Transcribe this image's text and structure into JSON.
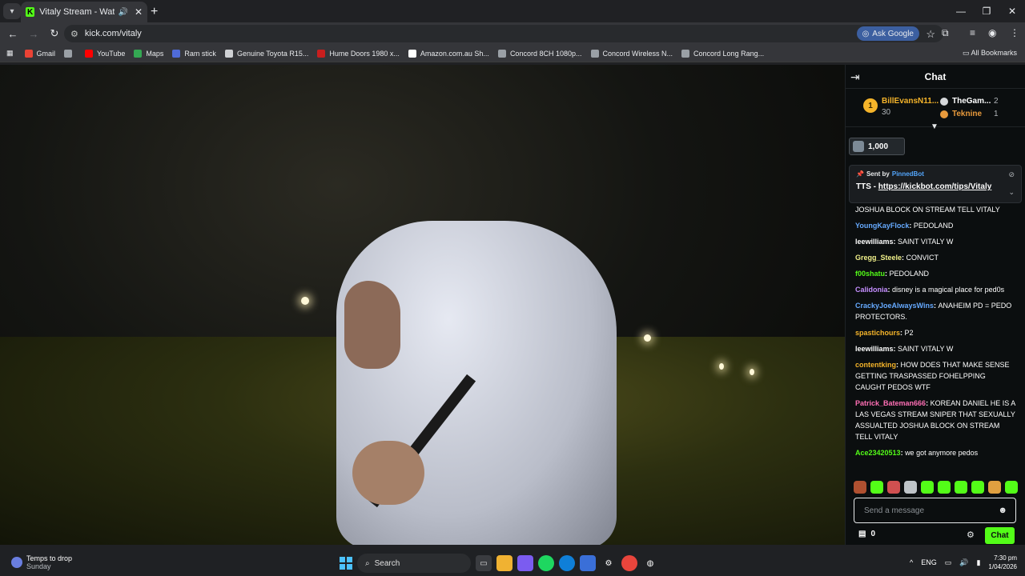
{
  "browser": {
    "tab_title": "Vitaly Stream - Watch Live o",
    "new_tab_icon": "plus-icon",
    "url": "kick.com/vitaly",
    "ask_google_label": "Ask Google",
    "bookmarks": [
      {
        "label": "Gmail",
        "color": "#ea4335"
      },
      {
        "label": "",
        "color": "#9aa0a6"
      },
      {
        "label": "YouTube",
        "color": "#ff0000"
      },
      {
        "label": "Maps",
        "color": "#34a853"
      },
      {
        "label": "Ram stick",
        "color": "#4f6bd8"
      },
      {
        "label": "Genuine Toyota R15...",
        "color": "#cfd1d4"
      },
      {
        "label": "Hume Doors 1980 x...",
        "color": "#c81e1e"
      },
      {
        "label": "Amazon.com.au Sh...",
        "color": "#ffffff"
      },
      {
        "label": "Concord 8CH 1080p...",
        "color": "#9aa0a6"
      },
      {
        "label": "Concord Wireless N...",
        "color": "#9aa0a6"
      },
      {
        "label": "Concord Long Rang...",
        "color": "#9aa0a6"
      }
    ],
    "all_bookmarks_label": "All Bookmarks"
  },
  "chat": {
    "title": "Chat",
    "leaderboard": {
      "rank": "1",
      "first_name": "BillEvansN11...",
      "first_count": "30",
      "second_name": "TheGam...",
      "second_count": "2",
      "third_name": "Teknine",
      "third_count": "1"
    },
    "gift_amount": "1,000",
    "pinned": {
      "sent_by": "Sent by",
      "bot_name": "PinnedBot",
      "tts_prefix": "TTS - ",
      "tts_link": "https://kickbot.com/tips/Vitaly"
    },
    "messages": [
      {
        "user": "",
        "text": "JOSHUA BLOCK ON STREAM TELL VITALY",
        "color": "#ffffff"
      },
      {
        "user": "YoungKayFlock",
        "text": "PEDOLAND",
        "color": "#66aaff"
      },
      {
        "user": "leewilliams",
        "text": "SAINT VITALY W",
        "color": "#ffffff"
      },
      {
        "user": "Gregg_Steele",
        "text": "CONVICT",
        "color": "#f0f08a"
      },
      {
        "user": "f00shatu",
        "text": "PEDOLAND",
        "color": "#53fc18"
      },
      {
        "user": "Calidonia",
        "text": "disney is a magical place for ped0s",
        "color": "#c58fff"
      },
      {
        "user": "CrackyJoeAlwaysWins",
        "text": "ANAHEIM PD = PEDO PROTECTORS.",
        "color": "#66aaff"
      },
      {
        "user": "spastichours",
        "text": "P2",
        "color": "#f5b42a"
      },
      {
        "user": "leewilliams",
        "text": "SAINT VITALY W",
        "color": "#ffffff"
      },
      {
        "user": "contentking",
        "text": "HOW DOES THAT MAKE SENSE GETTING TRASPASSED FOHELPPING CAUGHT PEDOS WTF",
        "color": "#f5b42a"
      },
      {
        "user": "Patrick_Bateman666",
        "text": "KOREAN DANIEL HE IS A LAS VEGAS STREAM SNIPER THAT SEXUALLY ASSUALTED JOSHUA BLOCK ON STREAM TELL VITALY",
        "color": "#ff6fb5"
      },
      {
        "user": "Ace23420513",
        "text": "we got anymore pedos",
        "color": "#53fc18"
      }
    ],
    "input_placeholder": "Send a message",
    "kicks_count": "0",
    "send_label": "Chat"
  },
  "taskbar": {
    "weather_title": "Temps to drop",
    "weather_day": "Sunday",
    "search_label": "Search",
    "lang": "ENG",
    "time": "7:30 pm",
    "date": "1/04/2026"
  }
}
